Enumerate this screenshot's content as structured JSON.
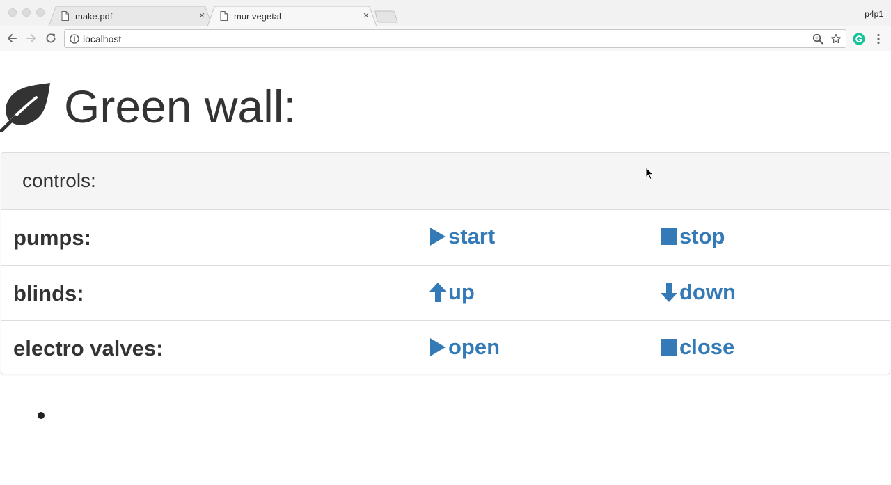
{
  "browser": {
    "tabs": [
      {
        "label": "make.pdf",
        "active": false
      },
      {
        "label": "mur vegetal",
        "active": true
      }
    ],
    "profile": "p4p1",
    "url": "localhost",
    "icons": {
      "back": "back-arrow-icon",
      "forward": "forward-arrow-icon",
      "reload": "reload-icon",
      "info": "info-icon",
      "zoom": "zoom-icon",
      "bookmark": "star-icon",
      "extension": "grammarly-icon",
      "menu": "kebab-menu-icon"
    }
  },
  "page": {
    "title": "Green wall:",
    "title_icon": "leaf-icon",
    "panel_heading": "controls:",
    "rows": [
      {
        "label": "pumps:",
        "actions": [
          {
            "label": "start",
            "icon": "play-icon"
          },
          {
            "label": "stop",
            "icon": "stop-icon"
          }
        ]
      },
      {
        "label": "blinds:",
        "actions": [
          {
            "label": "up",
            "icon": "arrow-up-icon"
          },
          {
            "label": "down",
            "icon": "arrow-down-icon"
          }
        ]
      },
      {
        "label": "electro valves:",
        "actions": [
          {
            "label": "open",
            "icon": "play-icon"
          },
          {
            "label": "close",
            "icon": "stop-icon"
          }
        ]
      }
    ],
    "colors": {
      "link": "#337ab7",
      "text": "#333333",
      "panel_heading_bg": "#f5f5f5",
      "border": "#dddddd"
    }
  }
}
